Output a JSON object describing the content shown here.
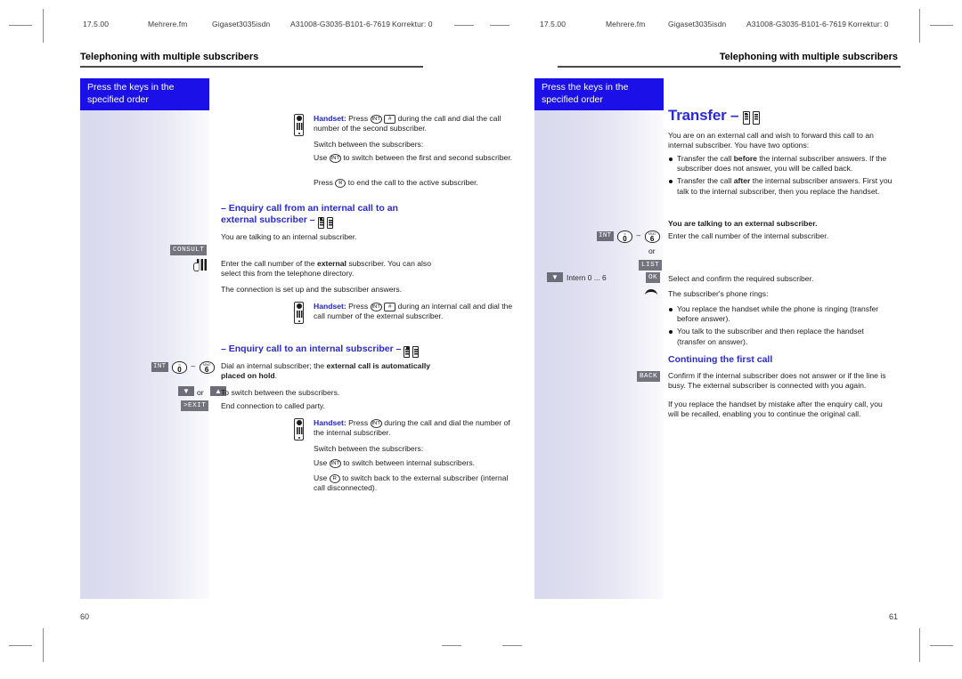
{
  "document": {
    "running_header": {
      "date": "17.5.00",
      "file": "Mehrere.fm",
      "product": "Gigaset3035isdn",
      "docnumber": "A31008-G3035-B101-6-7619",
      "revision": "Korrektur: 0"
    },
    "chapter_title": "Telephoning with multiple subscribers"
  },
  "left_page": {
    "folio": "60",
    "callout_box": "Press the keys in the specified order",
    "block1": {
      "handset_label": "Handset:",
      "line1_a": "Press",
      "key_int": "INT",
      "key_hash": "#",
      "line1_b": "during the call and dial the call number of the second subscriber.",
      "line2": "Switch between the subscribers:",
      "line3_a": "Use",
      "line3_key": "INT",
      "line3_b": "to switch between the first and second subscriber.",
      "line4_a": "Press",
      "line4_key": "R",
      "line4_b": "to end the call to the active subscriber."
    },
    "section1": {
      "heading": "– Enquiry call from an internal call to an external subscriber –",
      "intro": "You are talking to an internal subscriber.",
      "softkey_consult": "CONSULT",
      "text_keypad_a": "Enter the call number of the ",
      "text_keypad_bold": "external",
      "text_keypad_b": " subscriber. You can also select this from the telephone directory.",
      "text_connection": "The connection is set up and the subscriber answers.",
      "handset_label": "Handset:",
      "handset_a": "Press",
      "handset_key1": "INT",
      "handset_key2": "#",
      "handset_b": "during an internal call and dial the call number of the external subscriber."
    },
    "section2": {
      "heading": "– Enquiry call to an internal subscriber –",
      "key_int": "INT",
      "key_0_sub": "∞",
      "key_0": "0",
      "key_6_sub": "MNO",
      "key_6": "6",
      "dash": "–",
      "text_dial_a": "Dial an internal subscriber; the ",
      "text_dial_bold": "external call is automatically placed on hold",
      "text_dial_b": ".",
      "or_label": "or",
      "text_switch": "To switch between the subscribers.",
      "softkey_exit": ">EXIT",
      "text_end": "End connection to called party.",
      "handset_label": "Handset:",
      "handset_a": "Press",
      "handset_key": "INT",
      "handset_b": "during the call and dial the number of the internal subscriber.",
      "line2": "Switch between the subscribers:",
      "line3_a": "Use",
      "line3_key": "INT",
      "line3_b": "to switch between internal subscribers.",
      "line4_a": "Use",
      "line4_key": "R",
      "line4_b": "to switch back to the external subscriber (internal call disconnected)."
    }
  },
  "right_page": {
    "folio": "61",
    "callout_box": "Press the keys in the specified order",
    "title": "Transfer –",
    "intro": "You are on an external call and wish to forward this call to an internal subscriber. You have two options:",
    "bullets": [
      {
        "pre": "Transfer the call ",
        "bold": "before",
        "post": " the internal subscriber answers. If the subscriber does not answer, you will be called back."
      },
      {
        "pre": "Transfer the call ",
        "bold": "after",
        "post": " the internal subscriber answers. First you talk to the internal subscriber, then you replace the handset."
      }
    ],
    "bold_state": "You are talking to an external subscriber.",
    "key_int": "INT",
    "key_0_sub": "∞",
    "key_0": "0",
    "key_6_sub": "MNO",
    "key_6": "6",
    "dash": "–",
    "text_enter": "Enter the call number of the internal subscriber.",
    "or_label": "or",
    "softkey_list": "LIST",
    "display_line": "Intern 0 ... 6",
    "softkey_ok": "OK",
    "text_select": "Select and confirm the required subscriber.",
    "text_rings": "The subscriber's phone rings:",
    "bullets2": [
      "You replace the handset while the phone is ringing (transfer before answer).",
      "You talk to the subscriber and then replace the handset (transfer on answer)."
    ],
    "subheading": "Continuing the first call",
    "softkey_back": "BACK",
    "text_confirm": "Confirm if the internal subscriber does not answer or if the line is busy. The external subscriber is connected with you again.",
    "text_recall": "If you replace the handset by mistake after the enquiry call, you will be recalled, enabling you to continue the original call."
  }
}
